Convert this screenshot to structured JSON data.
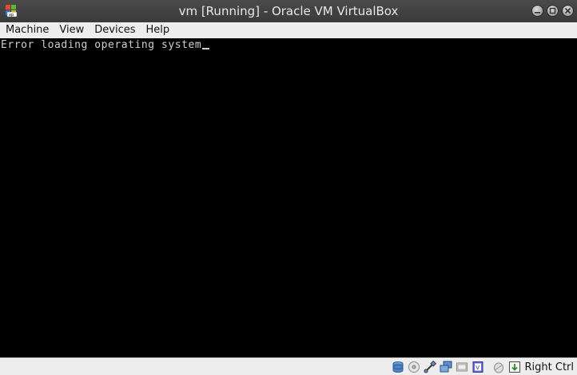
{
  "window": {
    "title": "vm [Running] - Oracle VM VirtualBox",
    "app_icon_label": "xp"
  },
  "menu": {
    "items": [
      "Machine",
      "View",
      "Devices",
      "Help"
    ]
  },
  "screen": {
    "console_text": "Error loading operating system"
  },
  "statusbar": {
    "icons": [
      "hard-disk-icon",
      "optical-drive-icon",
      "usb-icon",
      "network-icon",
      "shared-folders-icon",
      "video-capture-icon",
      "mouse-integration-icon",
      "host-key-icon"
    ],
    "host_key_label": "Right Ctrl"
  },
  "colors": {
    "titlebar": "#3a3a3a",
    "menubar": "#ededed",
    "screen": "#000000",
    "console_text": "#cfcfcf"
  }
}
